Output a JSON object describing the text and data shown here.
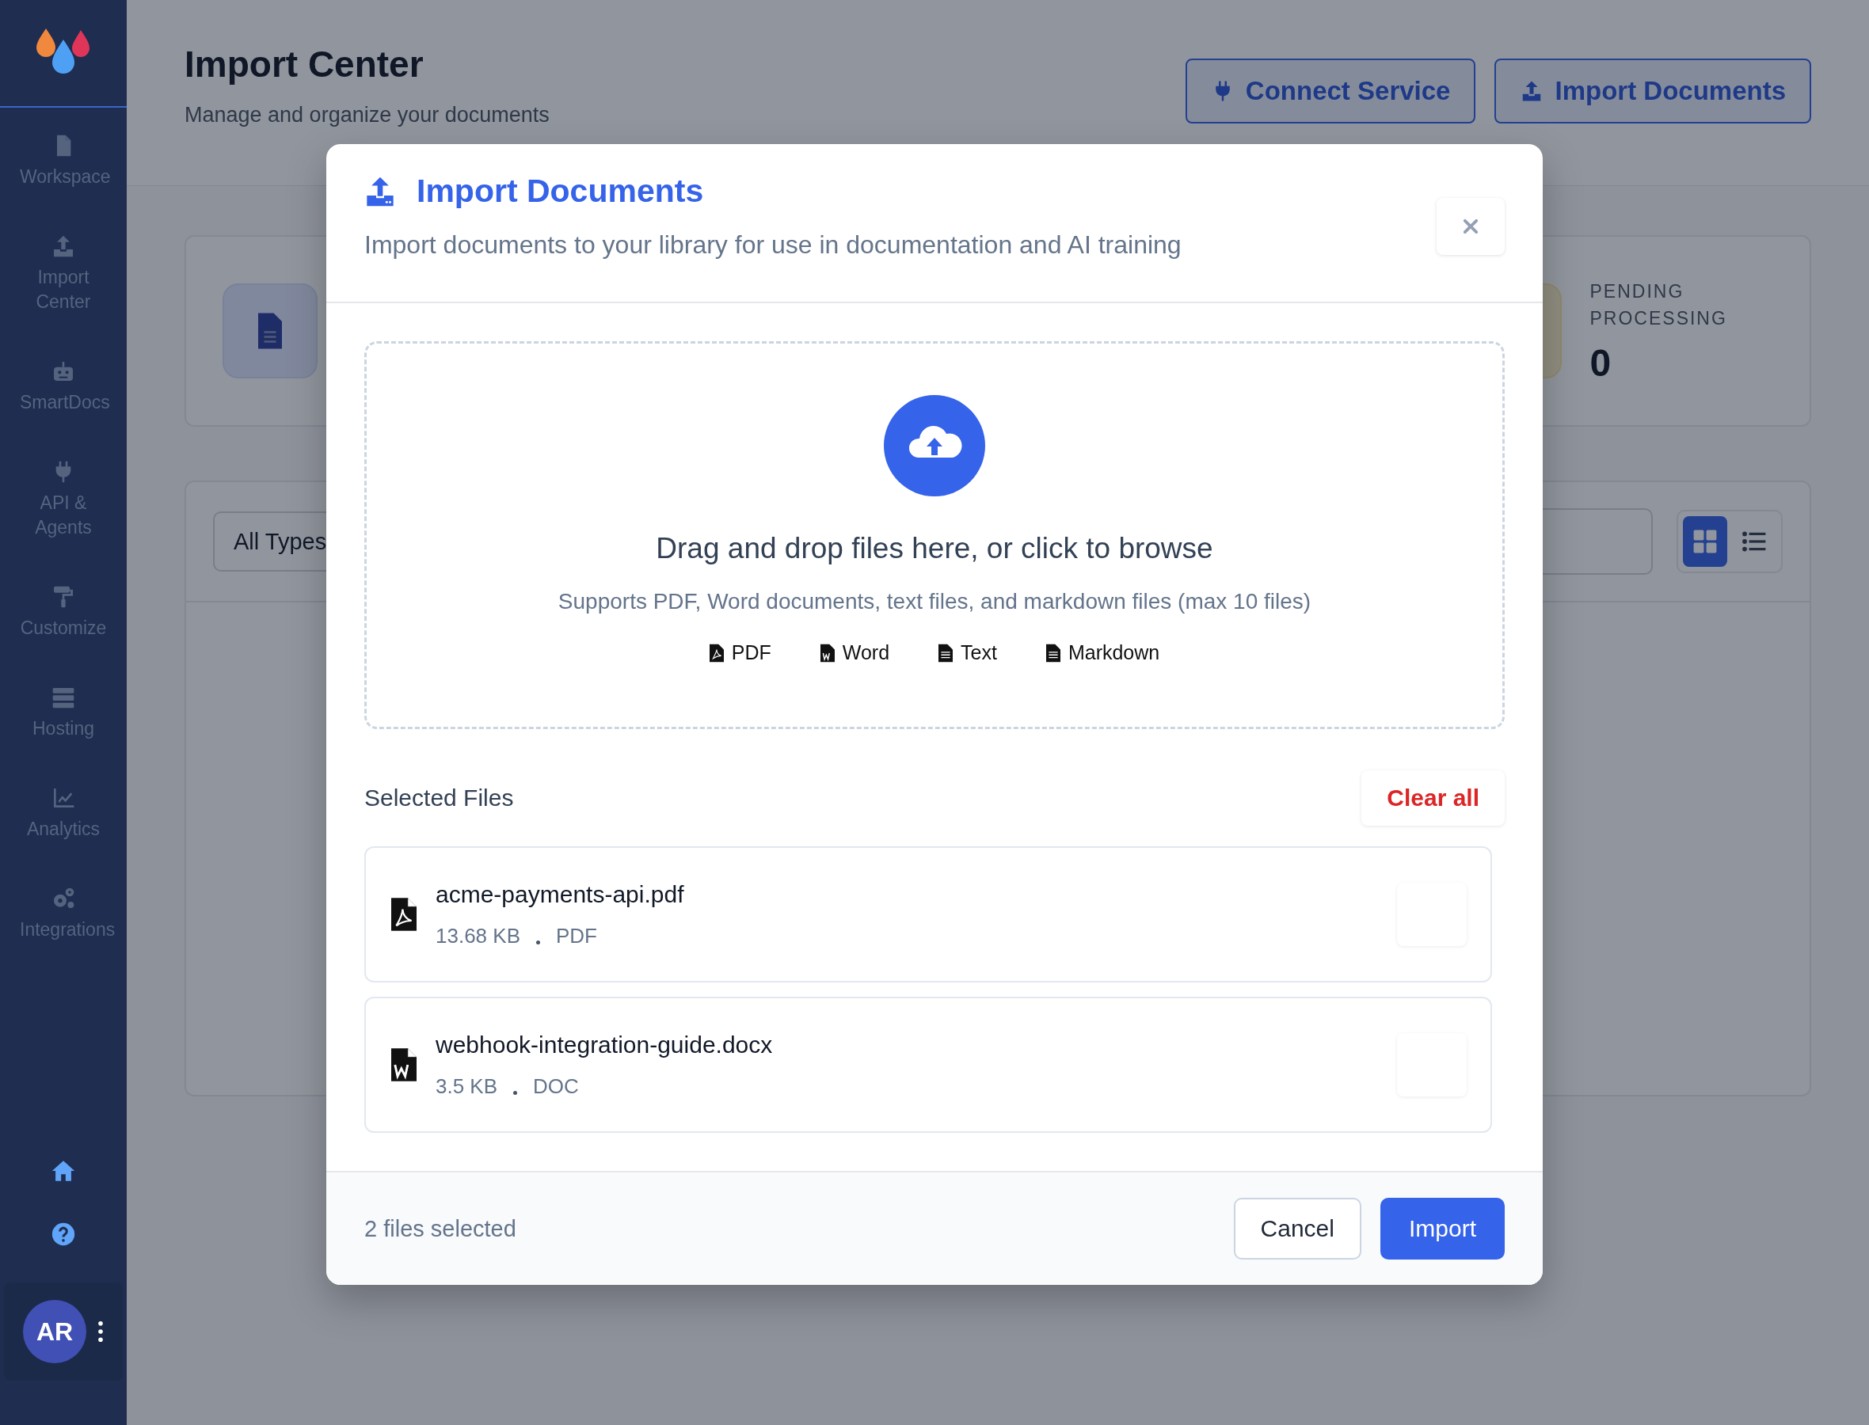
{
  "sidebar": {
    "items": [
      {
        "label": "Workspace",
        "kind": "file"
      },
      {
        "label": "Import Center",
        "kind": "upload"
      },
      {
        "label": "SmartDocs",
        "kind": "robot"
      },
      {
        "label": "API & Agents",
        "kind": "plug"
      },
      {
        "label": "Customize",
        "kind": "roller"
      },
      {
        "label": "Hosting",
        "kind": "server"
      },
      {
        "label": "Analytics",
        "kind": "chart"
      },
      {
        "label": "Integrations",
        "kind": "gears"
      }
    ],
    "user": {
      "initials": "AR"
    }
  },
  "header": {
    "title": "Import Center",
    "subtitle": "Manage and organize your documents",
    "buttons": [
      {
        "label": "Connect Service",
        "kind": "plug"
      },
      {
        "label": "Import Documents",
        "kind": "upload"
      }
    ]
  },
  "stat": {
    "label": "PENDING PROCESSING",
    "value": "0"
  },
  "filters": {
    "type_select": "All Types",
    "view_modes": [
      {
        "kind": "grid",
        "selected": true
      },
      {
        "kind": "list",
        "selected": false
      }
    ]
  },
  "modal": {
    "title": "Import Documents",
    "subtitle": "Import documents to your library for use in documentation and AI training",
    "dropzone": {
      "heading": "Drag and drop files here, or click to browse",
      "hint": "Supports PDF, Word documents, text files, and markdown files (max 10 files)",
      "types": [
        {
          "label": "PDF",
          "kind": "pdf"
        },
        {
          "label": "Word",
          "kind": "word"
        },
        {
          "label": "Text",
          "kind": "text"
        },
        {
          "label": "Markdown",
          "kind": "text"
        }
      ]
    },
    "selected_title": "Selected Files",
    "clear_label": "Clear all",
    "files": [
      {
        "name": "acme-payments-api.pdf",
        "size": "13.68 KB",
        "type": "PDF",
        "kind": "pdf"
      },
      {
        "name": "webhook-integration-guide.docx",
        "size": "3.5 KB",
        "type": "DOC",
        "kind": "word"
      }
    ],
    "status": "2 files selected",
    "buttons": [
      {
        "label": "Cancel",
        "kind": "secondary"
      },
      {
        "label": "Import",
        "kind": "primary"
      }
    ]
  }
}
